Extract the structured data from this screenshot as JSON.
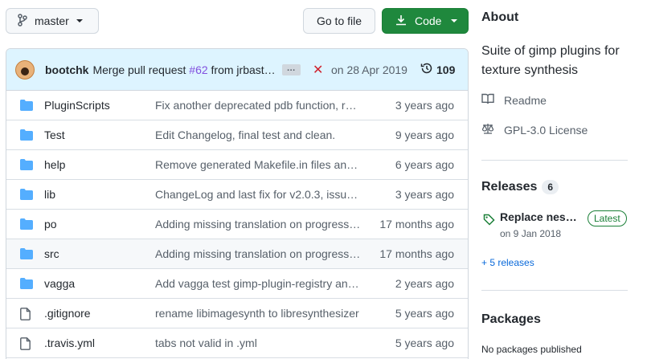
{
  "toolbar": {
    "branch_label": "master",
    "goto_label": "Go to file",
    "code_label": "Code"
  },
  "commit": {
    "author": "bootchk",
    "msg_prefix": "Merge pull request",
    "pr": "#62",
    "msg_suffix": "from jrbast…",
    "ellipsis": "…",
    "status_symbol": "✕",
    "date": "on 28 Apr 2019",
    "history_count": "109"
  },
  "files": [
    {
      "type": "folder",
      "name": "PluginScripts",
      "message": "Fix another deprecated pdb function, r…",
      "age": "3 years ago"
    },
    {
      "type": "folder",
      "name": "Test",
      "message": "Edit Changelog, final test and clean.",
      "age": "9 years ago"
    },
    {
      "type": "folder",
      "name": "help",
      "message": "Remove generated Makefile.in files an…",
      "age": "6 years ago"
    },
    {
      "type": "folder",
      "name": "lib",
      "message": "ChangeLog and last fix for v2.0.3, issu…",
      "age": "3 years ago"
    },
    {
      "type": "folder",
      "name": "po",
      "message": "Adding missing translation on progress…",
      "age": "17 months ago"
    },
    {
      "type": "folder",
      "name": "src",
      "message": "Adding missing translation on progress…",
      "age": "17 months ago"
    },
    {
      "type": "folder",
      "name": "vagga",
      "message": "Add vagga test gimp-plugin-registry an…",
      "age": "2 years ago"
    },
    {
      "type": "file",
      "name": ".gitignore",
      "message": "rename libimagesynth to libresynthesizer",
      "age": "5 years ago"
    },
    {
      "type": "file",
      "name": ".travis.yml",
      "message": "tabs not valid in .yml",
      "age": "5 years ago"
    }
  ],
  "about": {
    "title": "About",
    "description": "Suite of gimp plugins for texture synthesis",
    "readme": "Readme",
    "license": "GPL-3.0 License"
  },
  "releases": {
    "title": "Releases",
    "count": "6",
    "latest_name": "Replace nes…",
    "latest_badge": "Latest",
    "latest_date": "on 9 Jan 2018",
    "more": "+ 5 releases"
  },
  "packages": {
    "title": "Packages",
    "empty": "No packages published"
  },
  "colors": {
    "accent_green": "#1f883d",
    "commit_bg": "#ddf4ff",
    "folder": "#54aeff",
    "link": "#0969da",
    "pr_purple": "#8250df"
  }
}
